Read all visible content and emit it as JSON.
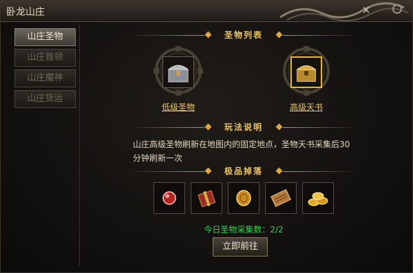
{
  "window": {
    "title": "卧龙山庄"
  },
  "sidebar": {
    "tabs": [
      {
        "label": "山庄圣物",
        "active": true
      },
      {
        "label": "山庄首领",
        "active": false
      },
      {
        "label": "山庄魔神",
        "active": false
      },
      {
        "label": "山庄货运",
        "active": false
      }
    ]
  },
  "items_section": {
    "header": "圣物列表",
    "items": [
      {
        "name": "低级圣物",
        "icon": "silver-chest-icon",
        "selected": false
      },
      {
        "name": "高级天书",
        "icon": "gold-chest-icon",
        "selected": true
      }
    ]
  },
  "rules_section": {
    "header": "玩法说明",
    "text_line1": "山庄高级圣物刷新在地图内的固定地点，圣物天书采集后30",
    "text_line2": "分钟刷新一次"
  },
  "drops_section": {
    "header": "极品掉落",
    "rewards": [
      {
        "icon": "red-orb-icon"
      },
      {
        "icon": "gift-box-icon"
      },
      {
        "icon": "gold-coin-icon"
      },
      {
        "icon": "scroll-icon"
      },
      {
        "icon": "gold-ingots-icon"
      }
    ]
  },
  "collect_count": {
    "label": "今日圣物采集数：2/2"
  },
  "go_button": {
    "label": "立即前往"
  },
  "colors": {
    "accent": "#f0c46a",
    "count_green": "#36d24e",
    "selected_border": "#e6b640"
  }
}
